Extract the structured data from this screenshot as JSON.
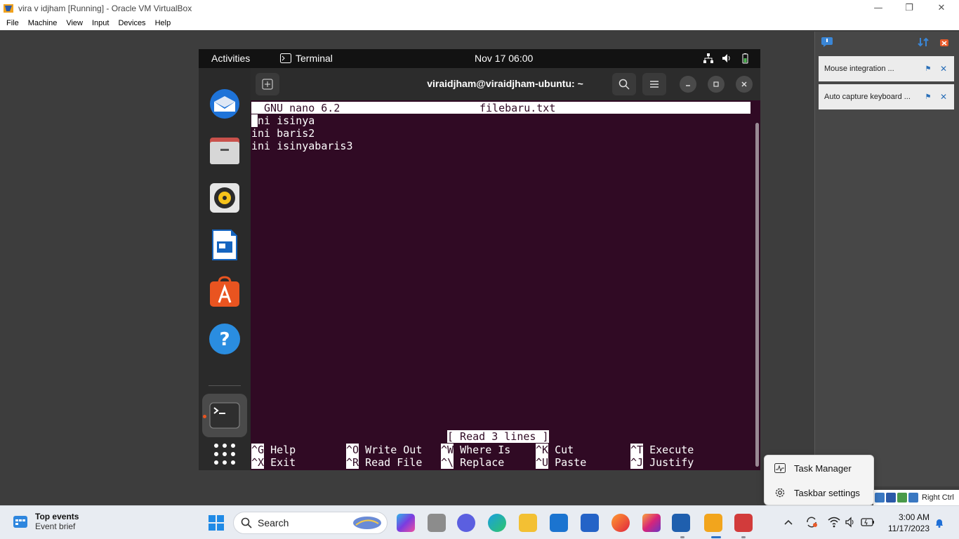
{
  "window": {
    "title": "vira v idjham  [Running] - Oracle VM VirtualBox",
    "minimize": "—",
    "restore": "❐",
    "close": "✕"
  },
  "menubar": [
    "File",
    "Machine",
    "View",
    "Input",
    "Devices",
    "Help"
  ],
  "gnome": {
    "activities": "Activities",
    "app_name": "Terminal",
    "clock": "Nov 17  06:00"
  },
  "terminal": {
    "title": "viraidjham@viraidjham-ubuntu: ~",
    "nano_version": "GNU nano 6.2",
    "filename": "filebaru.txt",
    "lines": [
      "ini isinya",
      "ini baris2",
      "ini isinyabaris3"
    ],
    "status": "[ Read 3 lines ]",
    "shortcuts_row1": [
      {
        "key": "^G",
        "label": " Help"
      },
      {
        "key": "^O",
        "label": " Write Out"
      },
      {
        "key": "^W",
        "label": " Where Is"
      },
      {
        "key": "^K",
        "label": " Cut"
      },
      {
        "key": "^T",
        "label": " Execute"
      }
    ],
    "shortcuts_row2": [
      {
        "key": "^X",
        "label": " Exit"
      },
      {
        "key": "^R",
        "label": " Read File"
      },
      {
        "key": "^\\",
        "label": " Replace"
      },
      {
        "key": "^U",
        "label": " Paste"
      },
      {
        "key": "^J",
        "label": " Justify"
      }
    ]
  },
  "notifications": [
    {
      "text": "Mouse integration ..."
    },
    {
      "text": "Auto capture keyboard ..."
    }
  ],
  "vb_status": {
    "host_key": "Right Ctrl"
  },
  "context_menu": {
    "task_manager": "Task Manager",
    "taskbar_settings": "Taskbar settings"
  },
  "taskbar": {
    "widget_title": "Top events",
    "widget_sub": "Event brief",
    "search": "Search",
    "time": "3:00 AM",
    "date": "11/17/2023"
  }
}
